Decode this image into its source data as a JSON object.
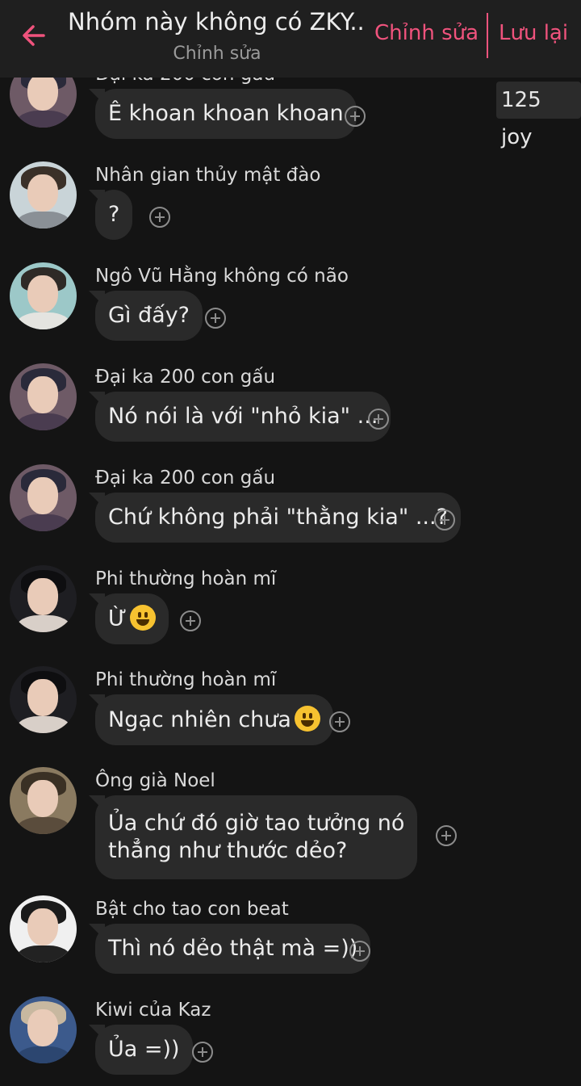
{
  "header": {
    "title": "Nhóm này không có ZKY...",
    "subtitle": "Chỉnh sửa",
    "edit_label": "Chỉnh sửa",
    "save_label": "Lưu lại",
    "accent_color": "#f0537d"
  },
  "joy_badge": "125 joy",
  "messages": [
    {
      "sender": "Đại ka 200 con gấu",
      "text": "Ê khoan khoan khoan"
    },
    {
      "sender": "Nhân gian thủy mật đào",
      "text": "?"
    },
    {
      "sender": "Ngô Vũ Hằng không có não",
      "text": "Gì đấy?"
    },
    {
      "sender": "Đại ka 200 con gấu",
      "text": "Nó nói là với \"nhỏ kia\" ..."
    },
    {
      "sender": "Đại ka 200 con gấu",
      "text": "Chứ không phải \"thằng kia\" ...?"
    },
    {
      "sender": "Phi thường hoàn mĩ",
      "text": "Ừ",
      "emoji": "grinning-face"
    },
    {
      "sender": "Phi thường hoàn mĩ",
      "text": "Ngạc nhiên chưa",
      "emoji": "grinning-face"
    },
    {
      "sender": "Ông già Noel",
      "text_line1": "Ủa chứ đó giờ tao tưởng nó",
      "text_line2": "thẳng như thước dẻo?"
    },
    {
      "sender": "Bật cho tao con beat",
      "text": "Thì nó dẻo thật mà =))"
    },
    {
      "sender": "Kiwi của Kaz",
      "text": "Ủa =))"
    }
  ]
}
